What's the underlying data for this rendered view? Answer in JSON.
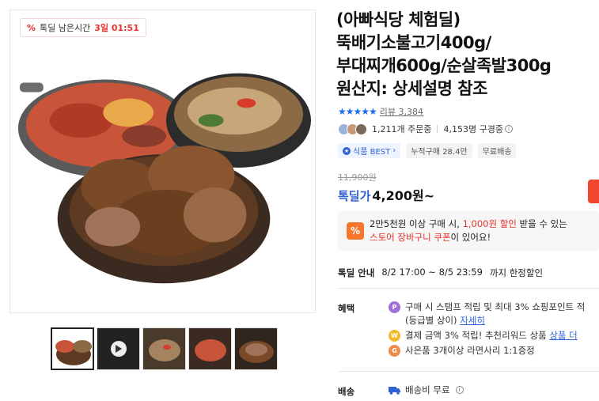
{
  "deal_badge": {
    "label": "톡딜 남은시간",
    "time": "3일 01:51"
  },
  "title": {
    "lines": [
      "(아빠식당 체험딜)",
      "뚝배기소불고기400g/",
      "부대찌개600g/순살족발300g",
      "원산지: 상세설명 참조"
    ]
  },
  "rating": {
    "stars": "★★★★★",
    "review_text": "리뷰 3,384"
  },
  "buyers": {
    "orders": "1,211개 주문중",
    "subscribers": "4,153명 구경중"
  },
  "badges": [
    "식품 BEST",
    "누적구매 28.4만",
    "무료배송"
  ],
  "price": {
    "original": "11,900원",
    "label": "톡딜가",
    "value": "4,200원~"
  },
  "coupon": {
    "line1_a": "2만5천원 이상 구매 시, ",
    "line1_hl": "1,000원 할인",
    "line1_b": " 받을 수 있는",
    "line2_hl": "스토어 장바구니 쿠폰",
    "line2_b": "이 있어요!"
  },
  "deal_info": {
    "label": "톡딜 안내",
    "period": "8/2 17:00 ~ 8/5 23:59",
    "suffix": "까지 한정할인"
  },
  "benefits": {
    "label": "혜택",
    "items": [
      {
        "text": "구매 시 스탬프 적립 및 최대 3% 쇼핑포인트 적",
        "sub": "(등급별 상이)",
        "link": "자세히"
      },
      {
        "text": "결제 금액 3% 적립! 추천리워드 상품",
        "link": "상품 더"
      },
      {
        "text": "사은품 3개이상 라면사리 1:1증정"
      }
    ]
  },
  "shipping": {
    "label": "배송",
    "text": "배송비 무료"
  },
  "colors": {
    "accent_blue": "#2f62d6",
    "accent_red": "#e8322b",
    "coupon_orange": "#f5762c"
  }
}
